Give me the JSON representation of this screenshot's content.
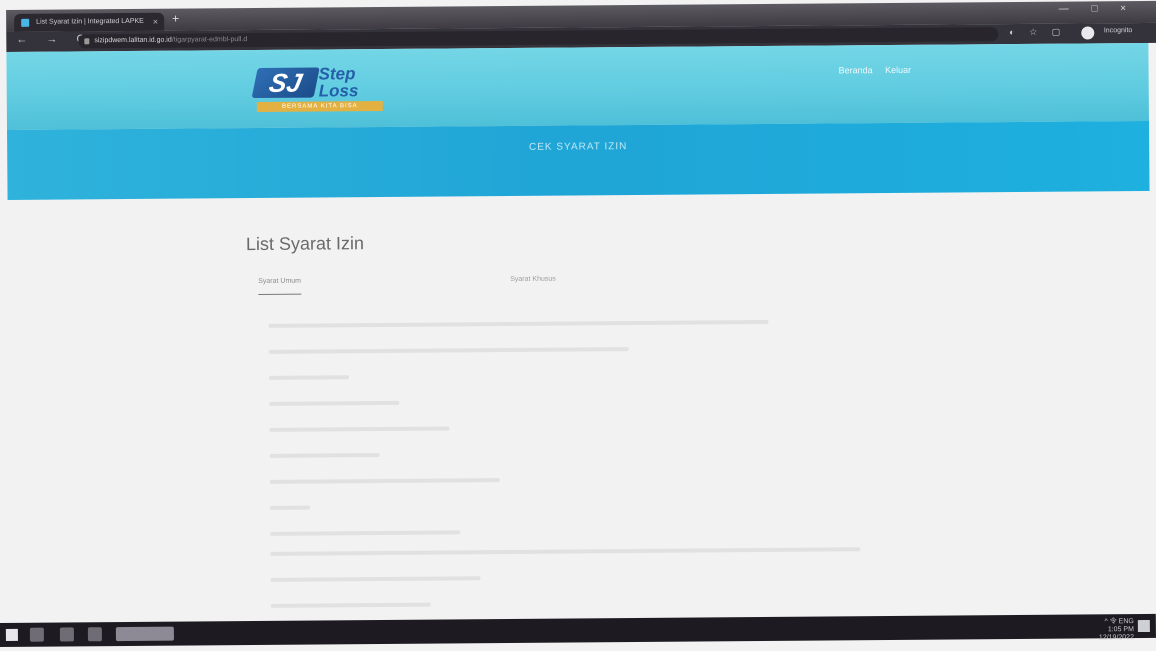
{
  "browser": {
    "tab_title": "List Syarat Izin | Integrated LAPKE",
    "tab_close": "×",
    "new_tab": "+",
    "window_controls": "— □ ×",
    "nav_icons": "← → C",
    "url_host": "sizipdwem.lalitan.id.go.id",
    "url_path": "/tigarpyarat-edmbl-pull.d",
    "extension_icons": "◐ ☆ ▢",
    "profile_label": "Incognito"
  },
  "site": {
    "logo_mark": "SJ",
    "logo_line1": "Step",
    "logo_line2": "Loss",
    "logo_tagline": "BERSAMA KITA BISA",
    "nav": [
      "Beranda",
      "Keluar"
    ],
    "banner_title": "CEK SYARAT IZIN"
  },
  "content": {
    "page_title": "List Syarat Izin",
    "tabs": [
      {
        "label": "Syarat Umum",
        "active": true
      },
      {
        "label": "Syarat Khusus",
        "active": false
      }
    ]
  },
  "taskbar": {
    "time": "1:05 PM",
    "date": "12/19/2022",
    "tray": "^ 令 ENG"
  }
}
